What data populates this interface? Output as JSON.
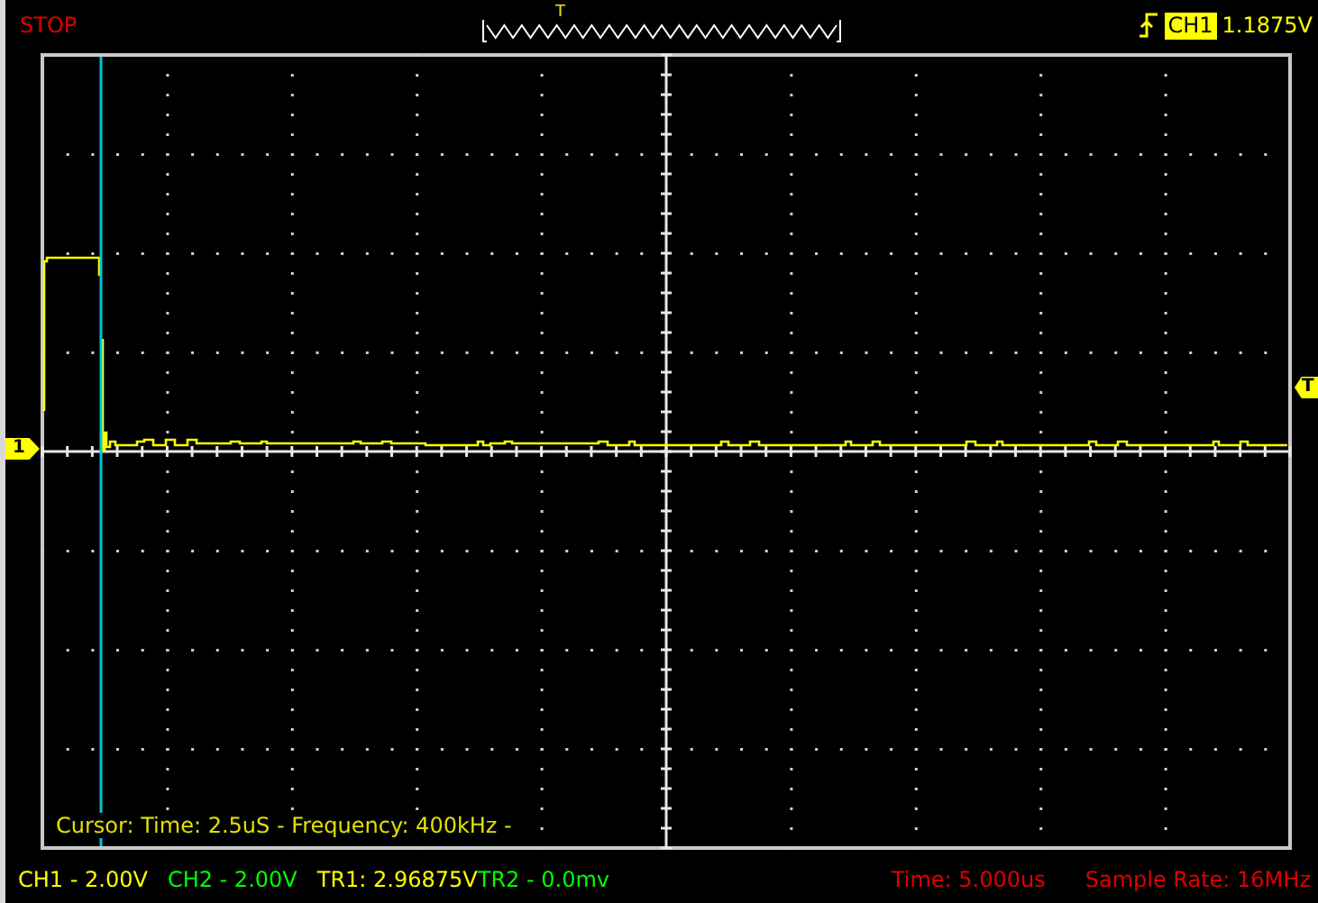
{
  "status": "STOP",
  "timeline": {
    "trigger_mark": "T"
  },
  "trigger": {
    "channel": "CH1",
    "level": "1.1875V"
  },
  "markers": [
    {
      "kind": "channel",
      "label": "1"
    },
    {
      "kind": "trigger",
      "label": "T"
    }
  ],
  "cursor_readout": "Cursor: Time: 2.5uS - Frequency: 400kHz -",
  "channel_readouts": [
    {
      "text": "CH1 - 2.00V",
      "color": "#ffff00"
    },
    {
      "text": "CH2 - 2.00V",
      "color": "#00ff00"
    },
    {
      "text": "TR1: 2.96875V",
      "color": "#ffff00"
    },
    {
      "text": "TR2 - 0.0mv",
      "color": "#00ff00"
    }
  ],
  "acquisition": [
    {
      "text": "Time: 5.000us"
    },
    {
      "text": "Sample Rate: 16MHz"
    }
  ]
}
